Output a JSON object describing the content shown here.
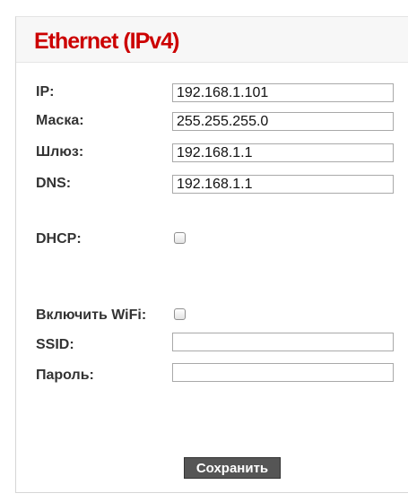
{
  "title": "Ethernet (IPv4)",
  "fields": {
    "ip": {
      "label": "IP:",
      "value": "192.168.1.101"
    },
    "mask": {
      "label": "Маска:",
      "value": "255.255.255.0"
    },
    "gateway": {
      "label": "Шлюз:",
      "value": "192.168.1.1"
    },
    "dns": {
      "label": "DNS:",
      "value": "192.168.1.1"
    }
  },
  "dhcp": {
    "label": "DHCP:",
    "checked": false
  },
  "wifi": {
    "label": "Включить WiFi:",
    "checked": false
  },
  "ssid": {
    "label": "SSID:",
    "value": ""
  },
  "password": {
    "label": "Пароль:",
    "value": ""
  },
  "save_label": "Сохранить",
  "colors": {
    "title": "#cc0000",
    "button": "#555555"
  }
}
